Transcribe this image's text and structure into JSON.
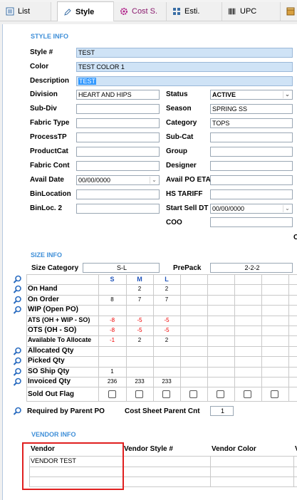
{
  "tabs": [
    {
      "label": "List",
      "icon": "list-icon",
      "active": false
    },
    {
      "label": "Style",
      "icon": "pencil-icon",
      "active": true
    },
    {
      "label": "Cost S.",
      "icon": "gear-icon",
      "active": false
    },
    {
      "label": "Esti.",
      "icon": "grid-icon",
      "active": false
    },
    {
      "label": "UPC",
      "icon": "barcode-icon",
      "active": false
    },
    {
      "label": "",
      "icon": "box-icon",
      "active": false
    }
  ],
  "style_info": {
    "title": "STYLE INFO",
    "style_label": "Style #",
    "style_value": "TEST",
    "color_label": "Color",
    "color_value": "TEST COLOR 1",
    "description_label": "Description",
    "description_value": "TEST",
    "division_label": "Division",
    "division_value": "HEART AND HIPS",
    "subdiv_label": "Sub-Div",
    "subdiv_value": "",
    "fabric_type_label": "Fabric Type",
    "fabric_type_value": "",
    "process_label": "ProcessTP",
    "process_value": "",
    "productcat_label": "ProductCat",
    "productcat_value": "",
    "fabric_cont_label": "Fabric Cont",
    "fabric_cont_value": "",
    "avail_date_label": "Avail Date",
    "avail_date_value": "00/00/0000",
    "binlocation_label": "BinLocation",
    "binlocation_value": "",
    "binloc2_label": "BinLoc. 2",
    "binloc2_value": "",
    "status_label": "Status",
    "status_value": "ACTIVE",
    "season_label": "Season",
    "season_value": "SPRING SS",
    "category_label": "Category",
    "category_value": "TOPS",
    "subcat_label": "Sub-Cat",
    "subcat_value": "",
    "group_label": "Group",
    "group_value": "",
    "designer_label": "Designer",
    "designer_value": "",
    "avail_po_label": "Avail PO ETA",
    "avail_po_value": "",
    "hs_tariff_label": "HS TARIFF",
    "hs_tariff_value": "",
    "start_sell_label": "Start Sell DT",
    "start_sell_value": "00/00/0000",
    "coo_label": "COO",
    "coo_value": "",
    "edge_char": "C"
  },
  "size_info": {
    "title": "SIZE INFO",
    "size_category_label": "Size Category",
    "size_category_value": "S-L",
    "prepack_label": "PrePack",
    "prepack_value": "2-2-2",
    "sizes": [
      "S",
      "M",
      "L"
    ],
    "rows": [
      {
        "label": "On Hand",
        "mag": true,
        "values": [
          "",
          "2",
          "2"
        ],
        "neg": false
      },
      {
        "label": "On Order",
        "mag": true,
        "values": [
          "8",
          "7",
          "7"
        ],
        "neg": false
      },
      {
        "label": "WIP (Open PO)",
        "mag": true,
        "values": [
          "",
          "",
          ""
        ],
        "neg": false
      },
      {
        "label": "ATS (OH + WIP - SO)",
        "mag": false,
        "values": [
          "-8",
          "-5",
          "-5"
        ],
        "neg": true
      },
      {
        "label": "OTS (OH - SO)",
        "mag": false,
        "values": [
          "-8",
          "-5",
          "-5"
        ],
        "neg": true
      },
      {
        "label": "Available To Allocate",
        "mag": false,
        "values": [
          "-1",
          "2",
          "2"
        ],
        "neg": false,
        "first_red": true
      },
      {
        "label": "Allocated Qty",
        "mag": true,
        "values": [
          "",
          "",
          ""
        ],
        "neg": false
      },
      {
        "label": "Picked Qty",
        "mag": true,
        "values": [
          "",
          "",
          ""
        ],
        "neg": false
      },
      {
        "label": "SO Ship Qty",
        "mag": true,
        "values": [
          "1",
          "",
          ""
        ],
        "neg": false
      },
      {
        "label": "Invoiced Qty",
        "mag": true,
        "values": [
          "236",
          "233",
          "233"
        ],
        "neg": false
      }
    ],
    "sold_out_label": "Sold Out Flag",
    "required_parent_label": "Required by Parent PO",
    "cost_sheet_parent_label": "Cost Sheet Parent Cnt",
    "cost_sheet_parent_value": "1"
  },
  "vendor_info": {
    "title": "VENDOR INFO",
    "columns": [
      "Vendor",
      "Vendor Style #",
      "Vendor Color",
      "V"
    ],
    "rows": [
      [
        "VENDOR TEST",
        "",
        "",
        ""
      ],
      [
        "",
        "",
        "",
        ""
      ],
      [
        "",
        "",
        "",
        ""
      ]
    ]
  },
  "colors": {
    "accent": "#3f8fd8",
    "highlight": "#e02020",
    "field_blue": "#cfe3f6"
  }
}
